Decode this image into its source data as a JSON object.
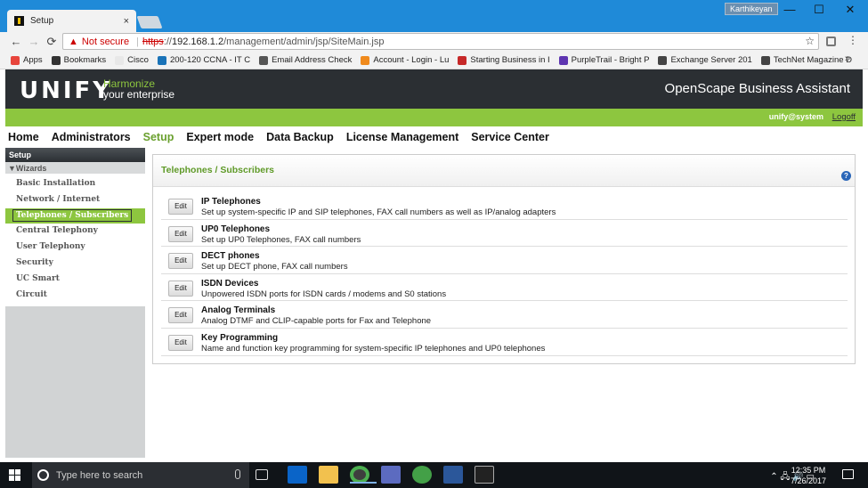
{
  "browser": {
    "tab_title": "Setup",
    "tab_close": "×",
    "user_badge": "Karthikeyan",
    "win_min": "—",
    "win_max": "☐",
    "win_close": "✕",
    "not_secure": "Not secure",
    "url_scheme": "https",
    "url_sep": "://",
    "url_host": "192.168.1.2",
    "url_path": "/management/admin/jsp/SiteMain.jsp",
    "bookmarks": [
      {
        "label": "Apps",
        "color": "#e8453c"
      },
      {
        "label": "Bookmarks",
        "color": "#333333"
      },
      {
        "label": "Cisco",
        "color": "#e8e8e8"
      },
      {
        "label": "200-120 CCNA - IT C",
        "color": "#1a73b8"
      },
      {
        "label": "Email Address Check",
        "color": "#555555"
      },
      {
        "label": "Account - Login - Lu",
        "color": "#f08a1c"
      },
      {
        "label": "Starting Business in I",
        "color": "#c62828"
      },
      {
        "label": "PurpleTrail - Bright P",
        "color": "#5e35b1"
      },
      {
        "label": "Exchange Server 201",
        "color": "#444444"
      },
      {
        "label": "TechNet Magazine D",
        "color": "#444444"
      }
    ],
    "bookmarks_more": "»"
  },
  "app": {
    "logo": "UNIFY",
    "tagline_1": "Harmonize",
    "tagline_2": "your enterprise",
    "product_name": "OpenScape Business Assistant",
    "user": "unify@system",
    "logoff": "Logoff",
    "nav": [
      "Home",
      "Administrators",
      "Setup",
      "Expert mode",
      "Data Backup",
      "License Management",
      "Service Center"
    ],
    "nav_active": "Setup"
  },
  "sidebar": {
    "header": "Setup",
    "group": "Wizards",
    "items": [
      "Basic Installation",
      "Network / Internet",
      "Telephones / Subscribers",
      "Central Telephony",
      "User Telephony",
      "Security",
      "UC Smart",
      "Circuit"
    ],
    "active": "Telephones / Subscribers"
  },
  "content": {
    "title": "Telephones / Subscribers",
    "help": "?",
    "edit_label": "Edit",
    "rows": [
      {
        "title": "IP Telephones",
        "desc": "Set up system-specific IP and SIP telephones, FAX call numbers as well as IP/analog adapters"
      },
      {
        "title": "UP0 Telephones",
        "desc": "Set up UP0 Telephones, FAX call numbers"
      },
      {
        "title": "DECT phones",
        "desc": "Set up DECT phone, FAX call numbers"
      },
      {
        "title": "ISDN Devices",
        "desc": "Unpowered ISDN ports for ISDN cards / modems and S0 stations"
      },
      {
        "title": "Analog Terminals",
        "desc": "Analog DTMF and CLIP-capable ports for Fax and Telephone"
      },
      {
        "title": "Key Programming",
        "desc": "Name and function key programming for system-specific IP telephones and UP0 telephones"
      }
    ]
  },
  "taskbar": {
    "search_placeholder": "Type here to search",
    "time": "12:35 PM",
    "date": "7/26/2017"
  }
}
